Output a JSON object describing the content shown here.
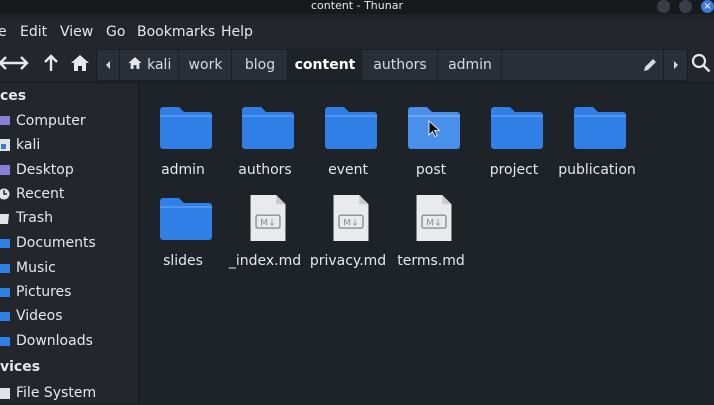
{
  "window": {
    "title": "content - Thunar"
  },
  "menubar": {
    "items": [
      "e",
      "Edit",
      "View",
      "Go",
      "Bookmarks",
      "Help"
    ]
  },
  "pathbar": {
    "crumbs": [
      "kali",
      "work",
      "blog",
      "content",
      "authors",
      "admin"
    ]
  },
  "sidebar": {
    "places_header": "ces",
    "devices_header": "vices",
    "places": [
      "Computer",
      "kali",
      "Desktop",
      "Recent",
      "Trash",
      "Documents",
      "Music",
      "Pictures",
      "Videos",
      "Downloads"
    ],
    "devices": [
      "File System"
    ]
  },
  "files": [
    {
      "name": "admin",
      "type": "folder"
    },
    {
      "name": "authors",
      "type": "folder"
    },
    {
      "name": "event",
      "type": "folder"
    },
    {
      "name": "post",
      "type": "folder"
    },
    {
      "name": "project",
      "type": "folder"
    },
    {
      "name": "publication",
      "type": "folder"
    },
    {
      "name": "slides",
      "type": "folder"
    },
    {
      "name": "_index.md",
      "type": "markdown"
    },
    {
      "name": "privacy.md",
      "type": "markdown"
    },
    {
      "name": "terms.md",
      "type": "markdown"
    }
  ],
  "colors": {
    "folder": "#2f7fe6",
    "accent": "#3d7ad8",
    "bg": "#1e2229"
  }
}
